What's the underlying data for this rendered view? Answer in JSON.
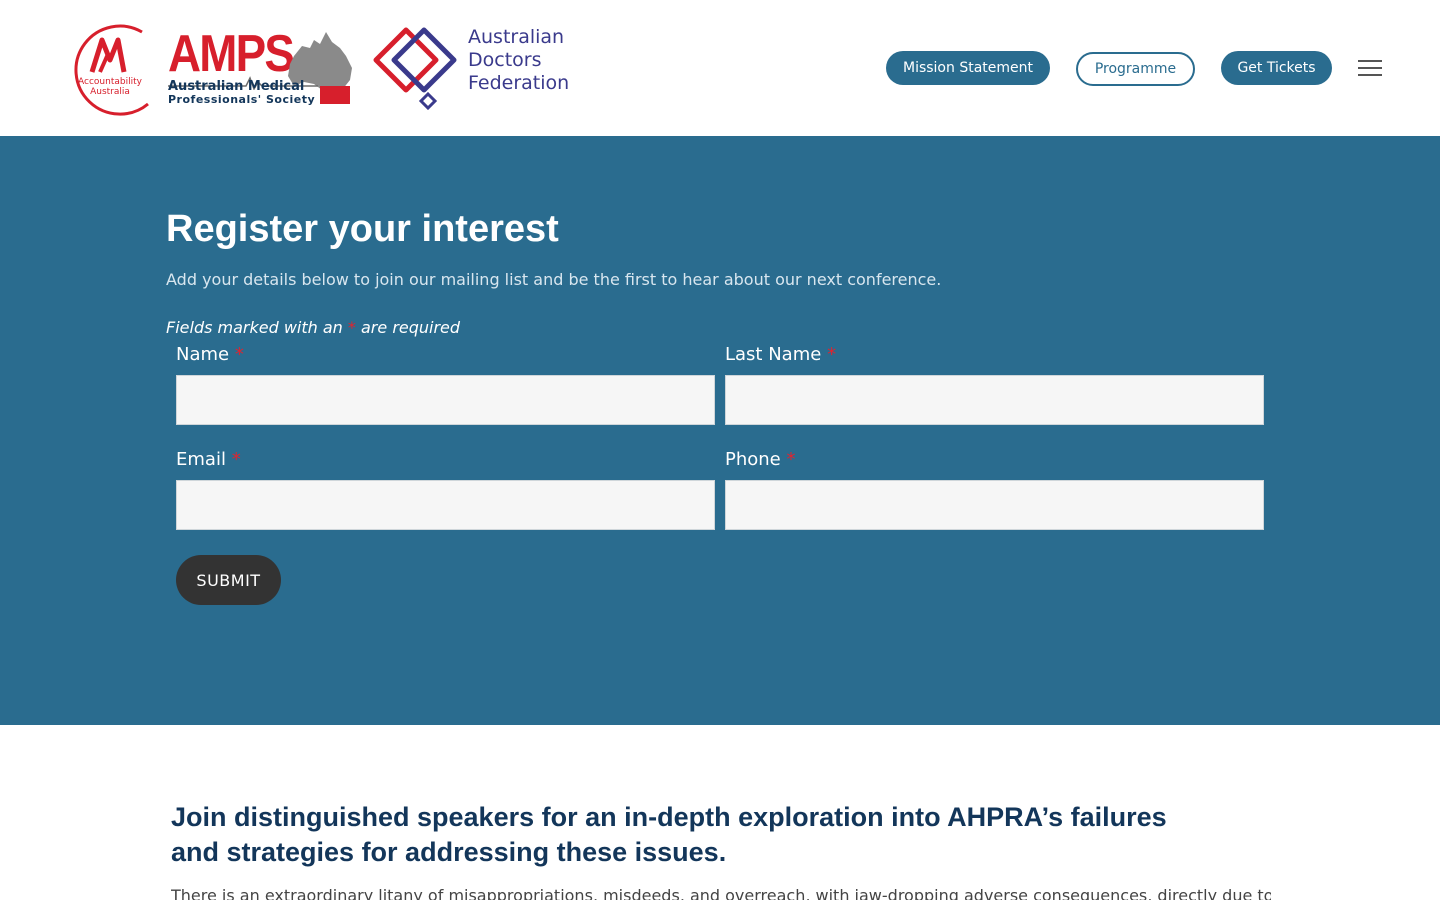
{
  "header": {
    "logos": {
      "accountability": {
        "line1": "Accountability",
        "line2": "Australia"
      },
      "amps": {
        "big": "AMPS",
        "line1": "Australian Medical",
        "line2": "Professionals' Society"
      },
      "adf": {
        "line1": "Australian",
        "line2": "Doctors",
        "line3": "Federation"
      }
    },
    "nav": [
      {
        "label": "Mission Statement"
      },
      {
        "label": "Programme"
      },
      {
        "label": "Get Tickets"
      }
    ],
    "menu_icon": "hamburger-icon"
  },
  "register": {
    "title": "Register your interest",
    "intro": "Add your details below to join our mailing list and be the first to hear about our next conference.",
    "required_prefix": "Fields marked with an",
    "required_star": "*",
    "required_suffix": "are required",
    "fields": {
      "name": {
        "label": "Name",
        "value": ""
      },
      "last_name": {
        "label": "Last Name",
        "value": ""
      },
      "email": {
        "label": "Email",
        "value": ""
      },
      "phone": {
        "label": "Phone",
        "value": ""
      }
    },
    "submit_label": "SUBMIT"
  },
  "speakers": {
    "heading": "Join distinguished speakers for an in-depth exploration into AHPRA’s failures and strategies for addressing these issues.",
    "body": "There is an extraordinary litany of misappropriations, misdeeds, and overreach, with jaw-dropping adverse consequences, directly due to"
  },
  "colors": {
    "primary": "#2a6c8f",
    "heading_dark": "#13365a",
    "required_red": "#e0242f",
    "logo_red": "#d71f2c",
    "adf_purple": "#3a3a8c"
  }
}
